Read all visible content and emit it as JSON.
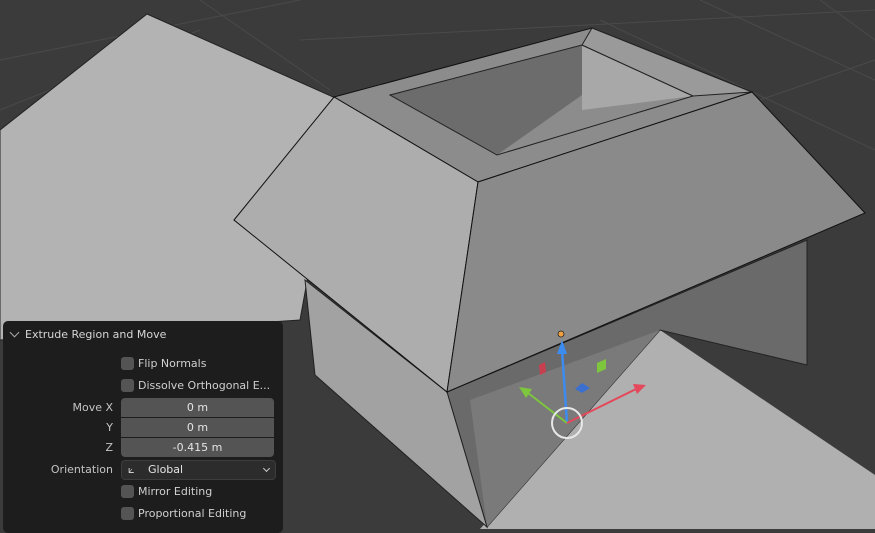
{
  "panel": {
    "title": "Extrude Region and Move",
    "flip_normals": {
      "label": "Flip Normals",
      "checked": false
    },
    "dissolve_orthogonal": {
      "label": "Dissolve Orthogonal E...",
      "checked": false
    },
    "move_label": "Move X",
    "y_label": "Y",
    "z_label": "Z",
    "move_x": "0 m",
    "move_y": "0 m",
    "move_z": "-0.415 m",
    "orientation_label": "Orientation",
    "orientation_value": "Global",
    "mirror_editing": {
      "label": "Mirror Editing",
      "checked": false
    },
    "proportional_editing": {
      "label": "Proportional Editing",
      "checked": false
    }
  },
  "colors": {
    "gizmo_x": "#e4485a",
    "gizmo_y": "#7dc63d",
    "gizmo_z": "#3c8cf0",
    "panel_bg": "#1d1d1d"
  }
}
